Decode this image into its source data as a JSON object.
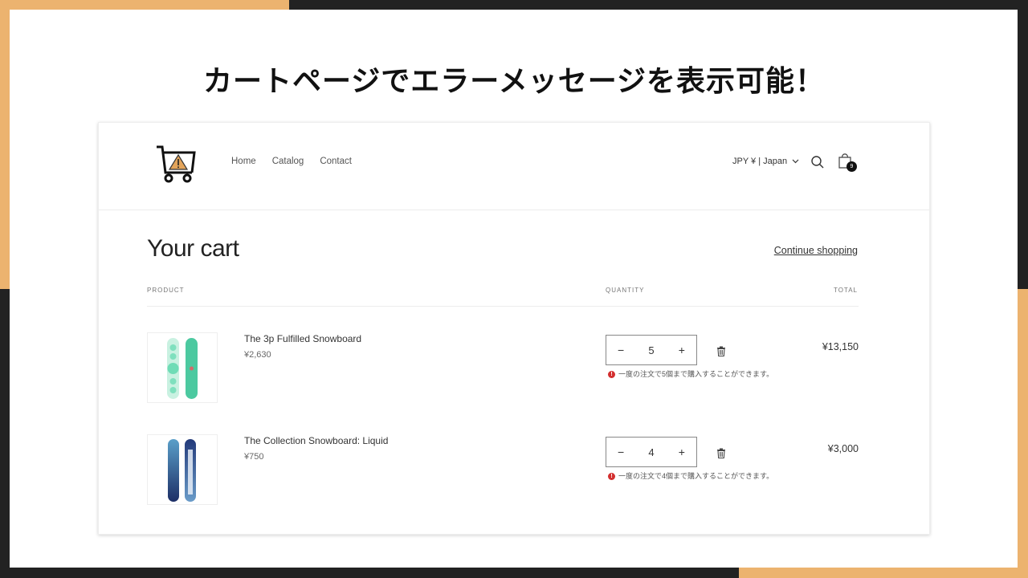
{
  "headline": "カートページでエラーメッセージを表示可能！",
  "colors": {
    "accent_orange": "#ecb36f",
    "background_dark": "#222222",
    "error_red": "#d32f2f"
  },
  "header": {
    "logo_icon": "cart-warning-icon",
    "nav": [
      "Home",
      "Catalog",
      "Contact"
    ],
    "locale": "JPY ¥ | Japan",
    "cart_count": "9"
  },
  "cart": {
    "title": "Your cart",
    "continue_label": "Continue shopping",
    "columns": {
      "product": "PRODUCT",
      "quantity": "QUANTITY",
      "total": "TOTAL"
    },
    "items": [
      {
        "name": "The 3p Fulfilled Snowboard",
        "price": "¥2,630",
        "quantity": "5",
        "total": "¥13,150",
        "error": "一度の注文で5個まで購入することができます。",
        "minus": "−",
        "plus": "+"
      },
      {
        "name": "The Collection Snowboard: Liquid",
        "price": "¥750",
        "quantity": "4",
        "total": "¥3,000",
        "error": "一度の注文で4個まで購入することができます。",
        "minus": "−",
        "plus": "+"
      }
    ]
  }
}
